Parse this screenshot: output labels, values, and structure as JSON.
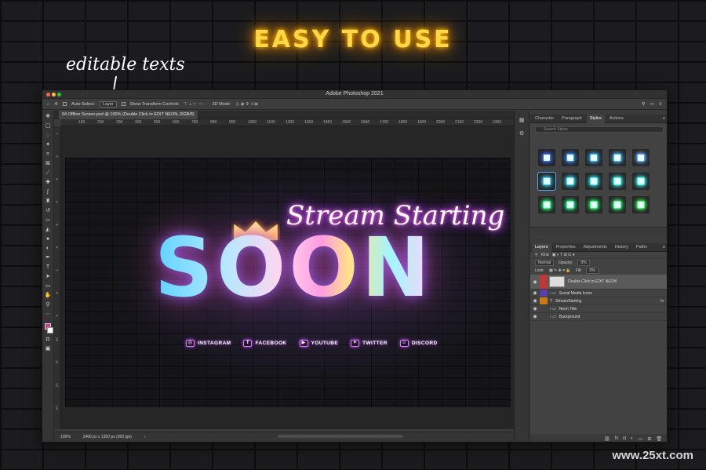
{
  "headline": "EASY TO USE",
  "annotation": "editable texts",
  "watermark": "www.25xt.com",
  "colors": {
    "headline_glow": "#ffb300",
    "accent_pink": "#d43b8c",
    "selection_blue": "#58a9ff"
  },
  "window": {
    "title": "Adobe Photoshop 2021"
  },
  "options_bar": {
    "auto_select_label": "Auto-Select:",
    "auto_select_value": "Layer",
    "show_transform_label": "Show Transform Controls",
    "mode_3d_label": "3D Mode:"
  },
  "document": {
    "tab_label": "04 Offline Screen.psd @ 100% (Double Click to EDIT NEON, RGB/8)",
    "zoom": "100%",
    "size_info": "2400 px x 1350 px (300 ppi)"
  },
  "ruler_h_ticks": [
    "100",
    "200",
    "300",
    "400",
    "500",
    "600",
    "700",
    "800",
    "900",
    "1000",
    "1100",
    "1200",
    "1300",
    "1400",
    "1500",
    "1600",
    "1700",
    "1800",
    "1900",
    "2000",
    "2100",
    "2200",
    "2300"
  ],
  "ruler_v_ticks": [
    "1",
    "2",
    "3",
    "4",
    "5",
    "6",
    "7",
    "8",
    "9",
    "10",
    "11",
    "12",
    "13"
  ],
  "artwork": {
    "script_line": "Stream Starting",
    "main_word": "SOON",
    "socials": [
      {
        "icon": "instagram-icon",
        "label": "INSTAGRAM"
      },
      {
        "icon": "facebook-icon",
        "label": "FACEBOOK"
      },
      {
        "icon": "youtube-icon",
        "label": "YOUTUBE"
      },
      {
        "icon": "twitter-icon",
        "label": "TWITTER"
      },
      {
        "icon": "discord-icon",
        "label": "DISCORD"
      }
    ]
  },
  "styles_panel": {
    "tabs": [
      "Character",
      "Paragraph",
      "Styles",
      "Actions"
    ],
    "active_tab": "Styles",
    "search_placeholder": "Search Styles",
    "swatch_colors": [
      "#3d6bff",
      "#3d8dff",
      "#3db1ff",
      "#4fb7ff",
      "#5fa8ff",
      "#3ad0ff",
      "#3de0ff",
      "#3df0ff",
      "#3dfff0",
      "#3dfff7",
      "#2cff7b",
      "#2cff90",
      "#2cff6b",
      "#3dff80",
      "#3dff5a"
    ]
  },
  "layers_panel": {
    "tabs": [
      "Layers",
      "Properties",
      "Adjustments",
      "History",
      "Paths"
    ],
    "active_tab": "Layers",
    "kind_filter": "Kind",
    "blend_mode": "Normal",
    "opacity_label": "Opacity:",
    "opacity_value": "0%",
    "lock_label": "Lock:",
    "fill_label": "Fill:",
    "fill_value": "0%",
    "layers": [
      {
        "name": "Double Click to EDIT NEON",
        "color": "#b83a3a",
        "type": "smart",
        "selected": true
      },
      {
        "name": "Social Media Icons",
        "color": "#5a3fa8",
        "type": "group"
      },
      {
        "name": "StreamStarting",
        "color": "#c87a18",
        "type": "text",
        "fx": "fx"
      },
      {
        "name": "Neon Title",
        "color": "",
        "type": "group"
      },
      {
        "name": "Background",
        "color": "",
        "type": "group"
      }
    ]
  }
}
